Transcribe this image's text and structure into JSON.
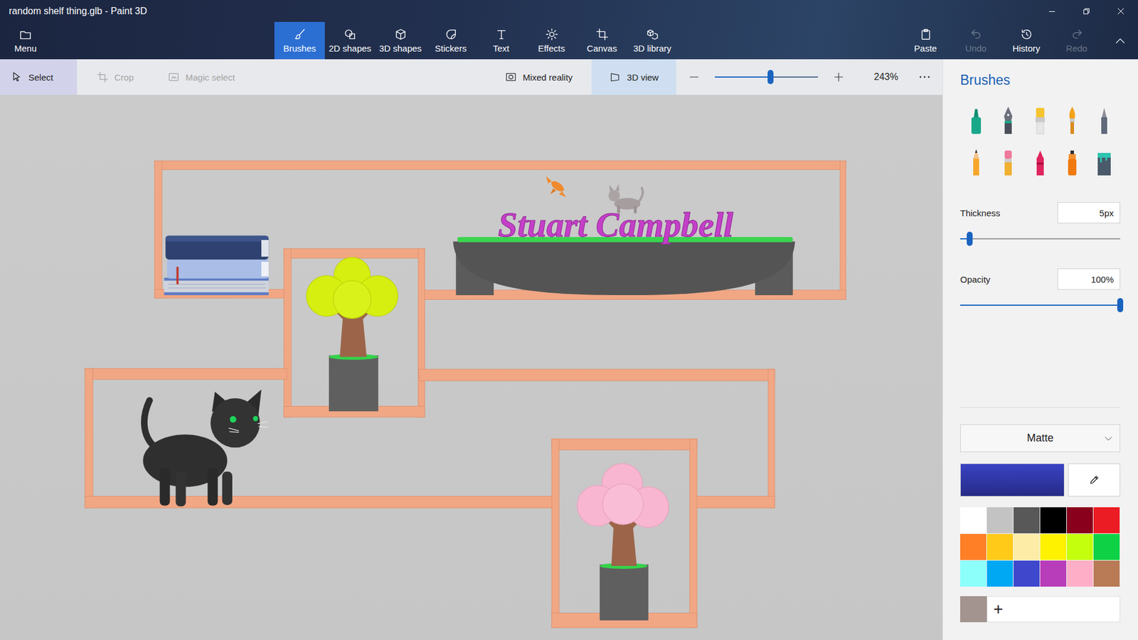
{
  "window": {
    "title": "random shelf thing.glb - Paint 3D"
  },
  "menu": {
    "label": "Menu"
  },
  "tools": [
    {
      "label": "Brushes",
      "selected": true
    },
    {
      "label": "2D shapes",
      "selected": false
    },
    {
      "label": "3D shapes",
      "selected": false
    },
    {
      "label": "Stickers",
      "selected": false
    },
    {
      "label": "Text",
      "selected": false
    },
    {
      "label": "Effects",
      "selected": false
    },
    {
      "label": "Canvas",
      "selected": false
    },
    {
      "label": "3D library",
      "selected": false
    }
  ],
  "actions": [
    {
      "label": "Paste",
      "disabled": false
    },
    {
      "label": "Undo",
      "disabled": true
    },
    {
      "label": "History",
      "disabled": false
    },
    {
      "label": "Redo",
      "disabled": true
    }
  ],
  "selection_tools": [
    {
      "label": "Select",
      "selected": true,
      "disabled": false
    },
    {
      "label": "Crop",
      "selected": false,
      "disabled": true
    },
    {
      "label": "Magic select",
      "selected": false,
      "disabled": true
    }
  ],
  "view": {
    "mixed_reality": {
      "label": "Mixed reality",
      "selected": false
    },
    "view_3d": {
      "label": "3D view",
      "selected": true
    }
  },
  "zoom": {
    "level": 0.54,
    "reading": "243%"
  },
  "scene": {
    "text": "Stuart Campbell"
  },
  "panel": {
    "title": "Brushes",
    "thickness": {
      "label": "Thickness",
      "value": "5px",
      "level": 0.06
    },
    "opacity": {
      "label": "Opacity",
      "value": "100%",
      "level": 1
    },
    "finish": {
      "label": "Matte"
    },
    "current_color": {
      "color": "#3a42c4"
    },
    "palette": [
      {
        "color": "#ffffff"
      },
      {
        "color": "#c3c3c3"
      },
      {
        "color": "#585858"
      },
      {
        "color": "#000000"
      },
      {
        "color": "#88001b"
      },
      {
        "color": "#ec1c24"
      },
      {
        "color": "#ff7f27"
      },
      {
        "color": "#ffca18"
      },
      {
        "color": "#fdeca6"
      },
      {
        "color": "#fff200"
      },
      {
        "color": "#c4ff0e"
      },
      {
        "color": "#0ed145"
      },
      {
        "color": "#8cfffb"
      },
      {
        "color": "#00a8f3"
      },
      {
        "color": "#3f48cc"
      },
      {
        "color": "#b83dba"
      },
      {
        "color": "#ffaec8"
      },
      {
        "color": "#b97a56"
      }
    ],
    "custom_colors": [
      {
        "color": "#a39490"
      }
    ],
    "add_color": {
      "label": "+"
    }
  }
}
